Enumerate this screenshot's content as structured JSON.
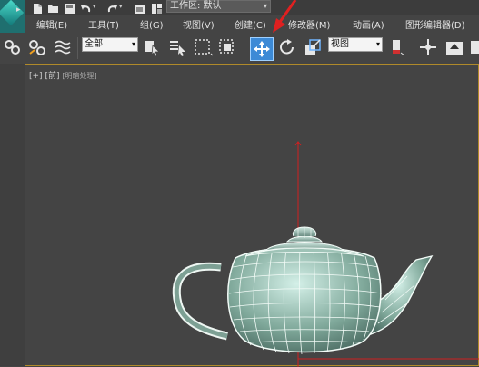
{
  "title_bar": {
    "workspace_label": "工作区: 默认"
  },
  "menu": {
    "items": [
      "编辑(E)",
      "工具(T)",
      "组(G)",
      "视图(V)",
      "创建(C)",
      "修改器(M)",
      "动画(A)",
      "图形编辑器(D)"
    ]
  },
  "toolbar": {
    "selection_filter": "全部",
    "coordinate_system": "视图"
  },
  "viewport": {
    "label_plus": "[+]",
    "label_view": "[前]",
    "label_shading": "[明暗处理]"
  },
  "colors": {
    "active_button": "#3d8ad6",
    "viewport_border": "#b08a2a",
    "annotation_arrow": "#e02020",
    "grid_axis": "#d02020"
  }
}
